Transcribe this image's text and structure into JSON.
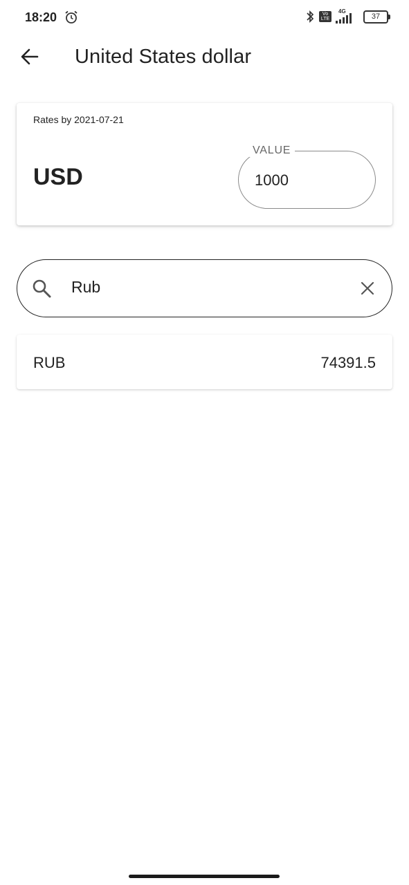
{
  "status_bar": {
    "time": "18:20",
    "network": "4G",
    "volte": "Vo LTE",
    "battery": "37"
  },
  "app_bar": {
    "title": "United States dollar",
    "back_icon": "arrow-left-icon"
  },
  "rate_card": {
    "rates_by": "Rates by 2021-07-21",
    "currency_code": "USD",
    "value_label": "VALUE",
    "value": "1000"
  },
  "search": {
    "query": "Rub",
    "icon": "search-icon",
    "clear_icon": "close-icon"
  },
  "results": [
    {
      "code": "RUB",
      "value": "74391.5"
    }
  ],
  "colors": {
    "text": "#212121",
    "outline": "#8a8a8a",
    "background": "#ffffff"
  }
}
